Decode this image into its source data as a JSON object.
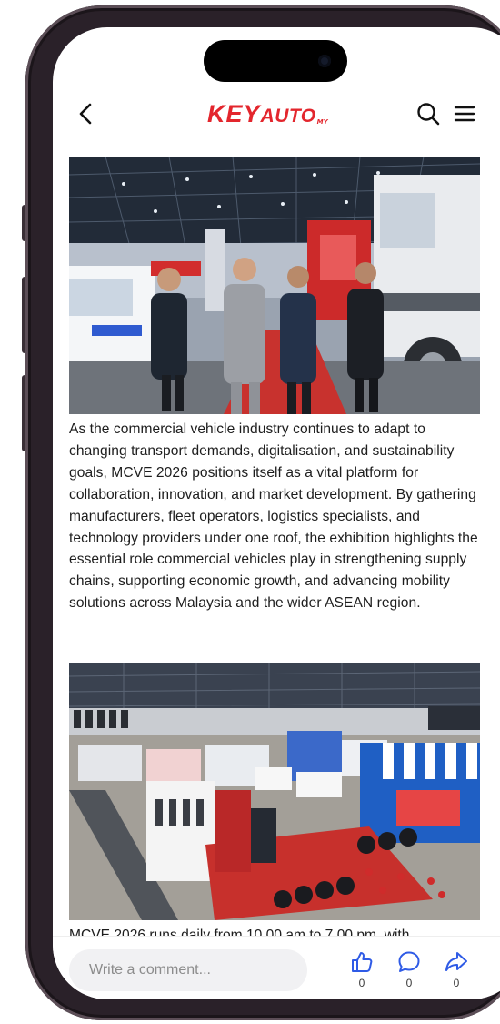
{
  "app": {
    "logo_primary": "KEY",
    "logo_secondary": "AUTO",
    "logo_suffix": "MY",
    "brand_color": "#e3262d",
    "accent_color": "#2f5be6"
  },
  "header": {
    "back_icon": "chevron-left-icon",
    "search_icon": "search-icon",
    "menu_icon": "hamburger-menu-icon"
  },
  "article": {
    "paragraph_1": "As the commercial vehicle industry continues to adapt to changing transport demands, digitalisation, and sustainability goals, MCVE 2026 positions itself as a vital platform for collaboration, innovation, and market development. By gathering manufacturers, fleet operators, logistics specialists, and technology providers under one roof, the exhibition highlights the essential role commercial vehicles play in strengthening supply chains, supporting economic growth, and advancing mobility solutions across Malaysia and the wider ASEAN region.",
    "paragraph_2_partial": "MCVE 2026 runs daily from 10.00 am to 7.00 pm, with"
  },
  "comment_bar": {
    "placeholder": "Write a comment...",
    "like_count": "0",
    "comment_count": "0",
    "share_count": "0",
    "like_icon": "thumbs-up-icon",
    "comment_icon": "speech-bubble-icon",
    "share_icon": "share-arrow-icon"
  }
}
